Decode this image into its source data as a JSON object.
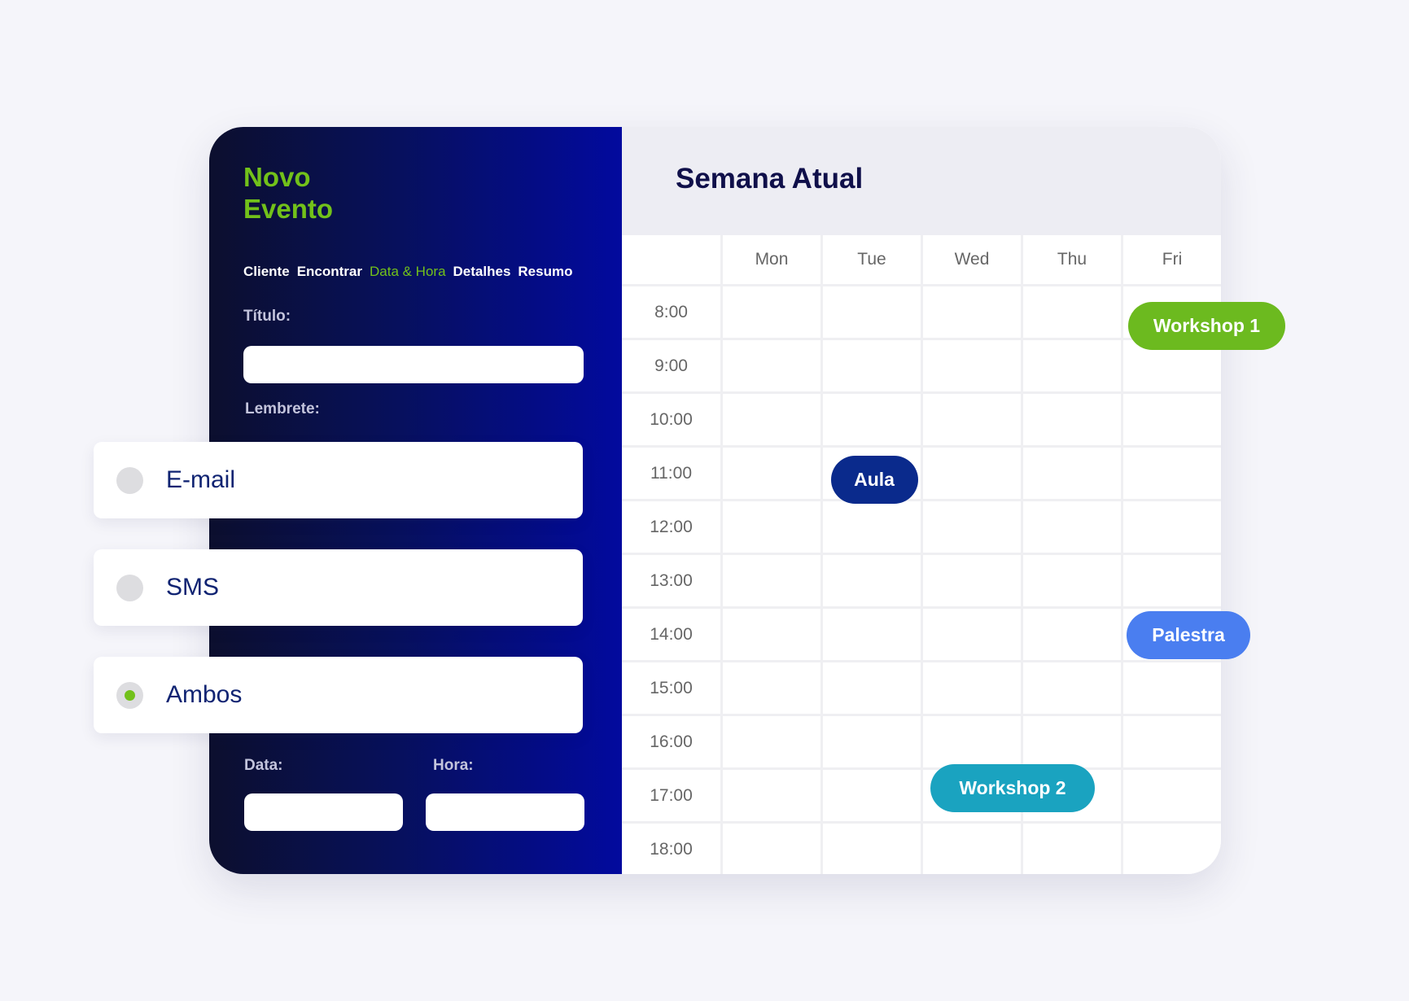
{
  "form": {
    "title_line1": "Novo",
    "title_line2": "Evento",
    "steps": [
      {
        "label": "Cliente",
        "active": false
      },
      {
        "label": "Encontrar",
        "active": false
      },
      {
        "label": "Data & Hora",
        "active": true
      },
      {
        "label": "Detalhes",
        "active": false
      },
      {
        "label": "Resumo",
        "active": false
      }
    ],
    "titulo_label": "Título:",
    "titulo_value": "",
    "lembrete_label": "Lembrete:",
    "reminder_options": [
      {
        "label": "E-mail",
        "selected": false
      },
      {
        "label": "SMS",
        "selected": false
      },
      {
        "label": "Ambos",
        "selected": true
      }
    ],
    "data_label": "Data:",
    "data_value": "",
    "hora_label": "Hora:",
    "hora_value": ""
  },
  "calendar": {
    "title": "Semana Atual",
    "days": [
      "Mon",
      "Tue",
      "Wed",
      "Thu",
      "Fri"
    ],
    "times": [
      "8:00",
      "9:00",
      "10:00",
      "11:00",
      "12:00",
      "13:00",
      "14:00",
      "15:00",
      "16:00",
      "17:00",
      "18:00"
    ],
    "events": [
      {
        "label": "Workshop 1",
        "day": "Fri",
        "time": "8:00",
        "color": "#6cba1f"
      },
      {
        "label": "Aula",
        "day": "Tue",
        "time": "11:00",
        "color": "#0a2a8c"
      },
      {
        "label": "Palestra",
        "day": "Fri",
        "time": "14:00",
        "color": "#4a7ef0"
      },
      {
        "label": "Workshop 2",
        "day": "Wed",
        "time": "17:00",
        "color": "#1aa3c0"
      }
    ]
  },
  "colors": {
    "accent_green": "#72c11a",
    "panel_dark": "#0c0f2e",
    "panel_blue": "#020a9e",
    "text_navy": "#0f2372"
  }
}
